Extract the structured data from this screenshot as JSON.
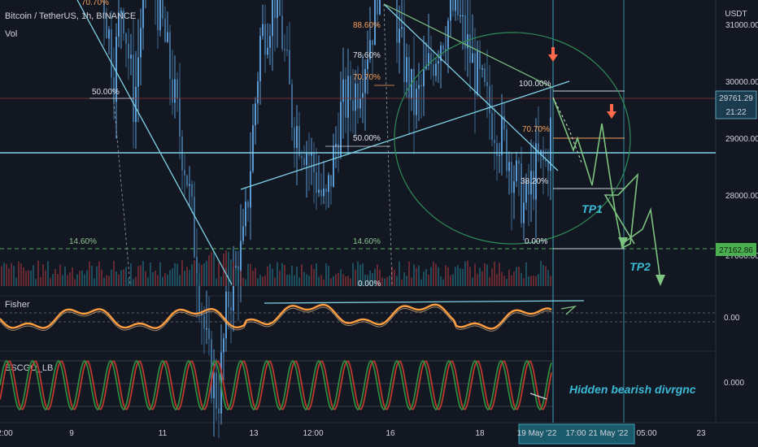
{
  "header": {
    "symbol": "Bitcoin / TetherUS, 1h, BINANCE",
    "volume_label": "Vol",
    "currency": "USDT"
  },
  "colors": {
    "background": "#131722",
    "up_candle": "#5b9bd5",
    "down_candle": "#3d6b93",
    "trendline": "#7fd3e6",
    "fisher_line": "#ff9f40",
    "escgo_green": "#2e8b3e",
    "escgo_red": "#c0392b",
    "projection": "#7cc47f",
    "fib_orange": "#f5a25d",
    "arrow_red": "#ff6b4a"
  },
  "chart_data": {
    "type": "line",
    "title": "Bitcoin / TetherUS, 1h, BINANCE",
    "y_axis": {
      "labels": [
        "31000.00",
        "30000.00",
        "29000.00",
        "28000.00",
        "27000.00"
      ],
      "range": [
        26500,
        31300
      ],
      "current_price": "29761.29",
      "countdown": "21:22",
      "target_price": "27162.86"
    },
    "x_axis": {
      "labels": [
        "2:00",
        "9",
        "11",
        "13",
        "12:00",
        "16",
        "18",
        "19 May '22",
        "17:00",
        "21 May '22",
        "05:00",
        "23"
      ]
    },
    "fib_levels": [
      {
        "label": "70.70%",
        "color": "orange"
      },
      {
        "label": "50.00%",
        "color": "white"
      },
      {
        "label": "14.60%",
        "color": "green"
      },
      {
        "label": "88.60%",
        "color": "orange"
      },
      {
        "label": "78.60%",
        "color": "white"
      },
      {
        "label": "70.70%",
        "color": "orange"
      },
      {
        "label": "50.00%",
        "color": "white"
      },
      {
        "label": "14.60%",
        "color": "green"
      },
      {
        "label": "0.00%",
        "color": "white"
      },
      {
        "label": "100.00%",
        "color": "white"
      },
      {
        "label": "70.70%",
        "color": "orange"
      },
      {
        "label": "38.20%",
        "color": "white"
      },
      {
        "label": "0.00%",
        "color": "white"
      }
    ],
    "annotations": {
      "tp1": "TP1",
      "tp2": "TP2",
      "divergence_note": "Hidden bearish divrgnc"
    },
    "indicators": {
      "fisher": {
        "name": "Fisher",
        "levels": [
          "0.00"
        ]
      },
      "escgo": {
        "name": "ESCGO_LB",
        "levels": [
          "0.000"
        ]
      }
    }
  }
}
